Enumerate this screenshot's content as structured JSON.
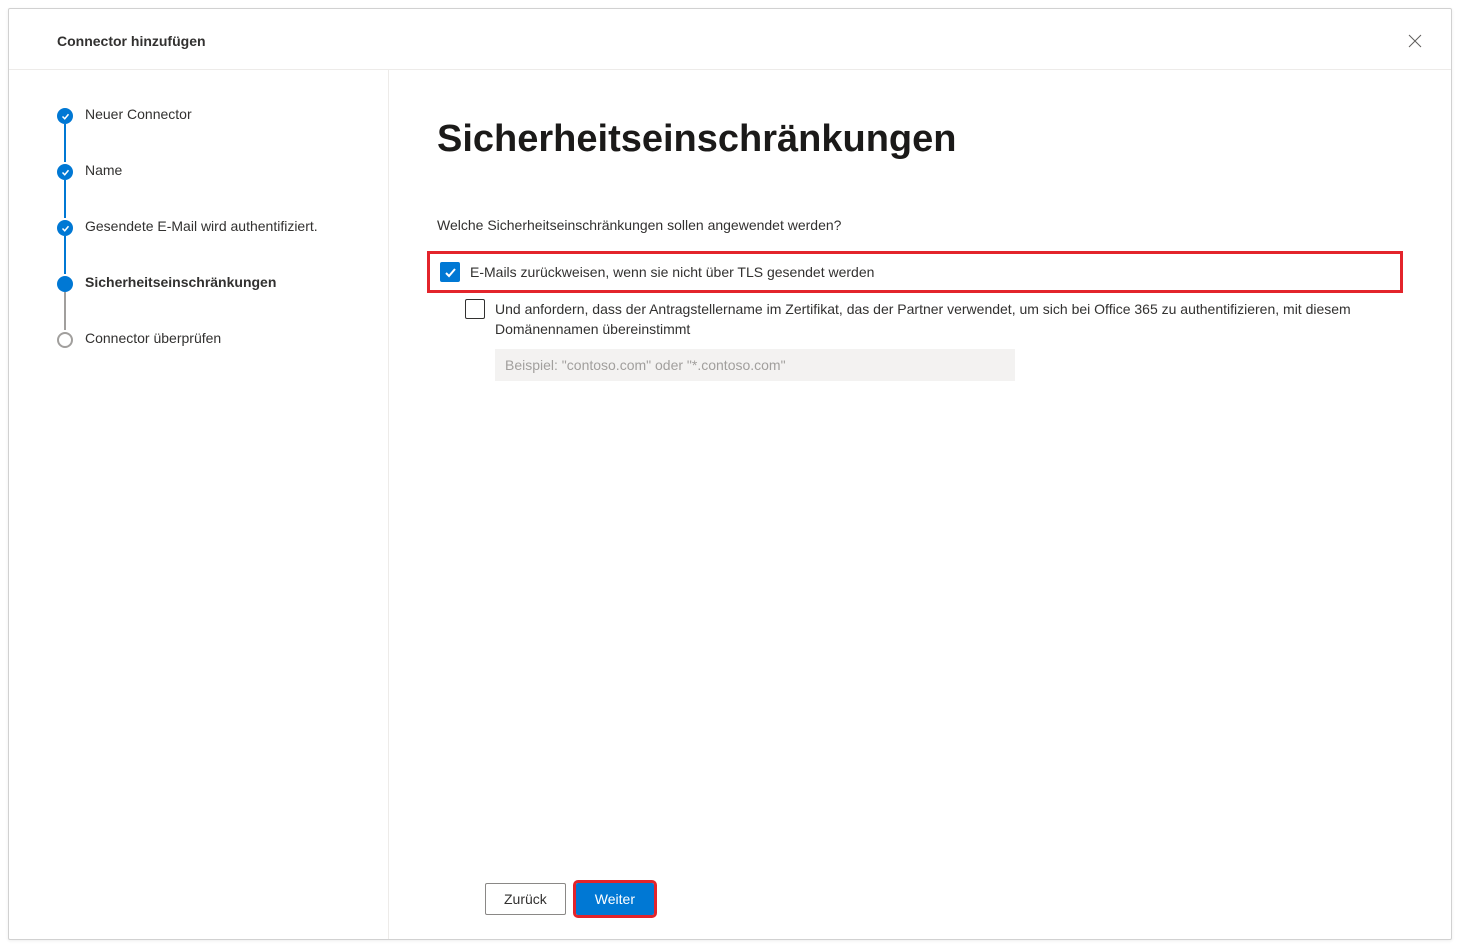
{
  "dialog": {
    "title": "Connector hinzufügen"
  },
  "steps": [
    {
      "label": "Neuer Connector",
      "state": "completed"
    },
    {
      "label": "Name",
      "state": "completed"
    },
    {
      "label": "Gesendete E-Mail wird authentifiziert.",
      "state": "completed"
    },
    {
      "label": "Sicherheitseinschränkungen",
      "state": "current"
    },
    {
      "label": "Connector überprüfen",
      "state": "upcoming"
    }
  ],
  "main": {
    "heading": "Sicherheitseinschränkungen",
    "question": "Welche Sicherheitseinschränkungen sollen angewendet werden?",
    "checkbox_tls": {
      "label": "E-Mails zurückweisen, wenn sie nicht über TLS gesendet werden",
      "checked": true
    },
    "checkbox_cert": {
      "label": "Und anfordern, dass der Antragstellername im Zertifikat, das der Partner verwendet, um sich bei Office 365 zu authentifizieren, mit diesem Domänennamen übereinstimmt",
      "checked": false
    },
    "domain_input": {
      "placeholder": "Beispiel: \"contoso.com\" oder \"*.contoso.com\"",
      "value": ""
    }
  },
  "footer": {
    "back_label": "Zurück",
    "next_label": "Weiter"
  }
}
